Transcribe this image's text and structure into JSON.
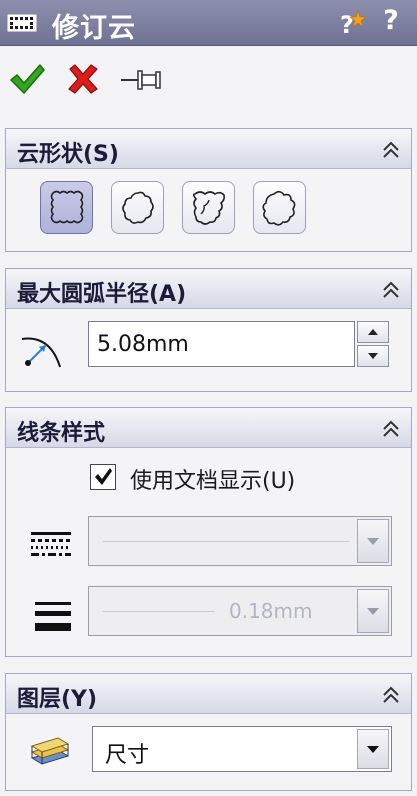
{
  "title": "修订云",
  "colors": {
    "title_bar": "#7d7fa1",
    "ok_green": "#2e9e1f",
    "cancel_red": "#d21f1f",
    "panel_header": "#dcdeea",
    "selected_shape": "#b9bbe0"
  },
  "header_icons": [
    "whatsnew-icon",
    "help-icon"
  ],
  "help_glyph": "?",
  "actions": [
    "ok-checkmark-icon",
    "cancel-x-icon",
    "pushpin-icon"
  ],
  "panels": {
    "cloud_shape": {
      "title": "云形状(S)",
      "shapes": [
        "rectangle-cloud",
        "ellipse-cloud",
        "irregular-polygon-cloud",
        "freehand-cloud"
      ],
      "selected": "rectangle-cloud"
    },
    "max_arc_radius": {
      "title": "最大圆弧半径(A)",
      "value": "5.08mm"
    },
    "line_style": {
      "title": "线条样式",
      "use_document_display_label": "使用文档显示(U)",
      "use_document_display_checked": true,
      "line_thickness_value": "0.18mm"
    },
    "layer": {
      "title": "图层(Y)",
      "value": "尺寸"
    }
  }
}
